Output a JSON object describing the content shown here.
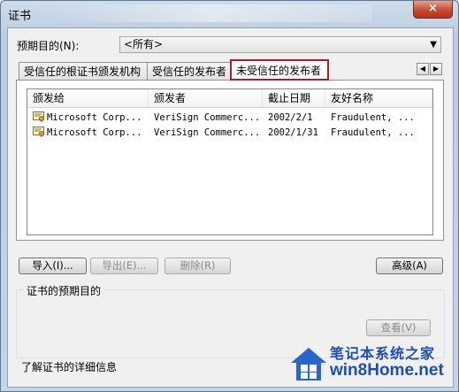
{
  "window": {
    "title": "证书",
    "close_label": "×"
  },
  "purpose": {
    "label": "预期目的(N):",
    "selected": "<所有>"
  },
  "tabs": [
    {
      "label": "受信任的根证书颁发机构"
    },
    {
      "label": "受信任的发布者"
    },
    {
      "label": "未受信任的发布者"
    }
  ],
  "tab_scroll": {
    "left": "◀",
    "right": "▶"
  },
  "list": {
    "columns": [
      "颁发给",
      "颁发者",
      "截止日期",
      "友好名称"
    ],
    "rows": [
      {
        "issued_to": "Microsoft Corp...",
        "issuer": "VeriSign Commerc...",
        "expires": "2002/2/1",
        "friendly": "Fraudulent, ..."
      },
      {
        "issued_to": "Microsoft Corp...",
        "issuer": "VeriSign Commerc...",
        "expires": "2002/1/31",
        "friendly": "Fraudulent, ..."
      }
    ]
  },
  "buttons": {
    "import": "导入(I)...",
    "export": "导出(E)...",
    "remove": "删除(R)",
    "advanced": "高级(A)",
    "view": "查看(V)"
  },
  "group": {
    "title": "证书的预期目的"
  },
  "learn_more": "了解证书的详细信息",
  "watermark": {
    "line1": "笔记本系统之家",
    "line2": "win8Home.net"
  },
  "colors": {
    "active_tab_border": "#b01c26",
    "watermark": "#1f4fae"
  }
}
